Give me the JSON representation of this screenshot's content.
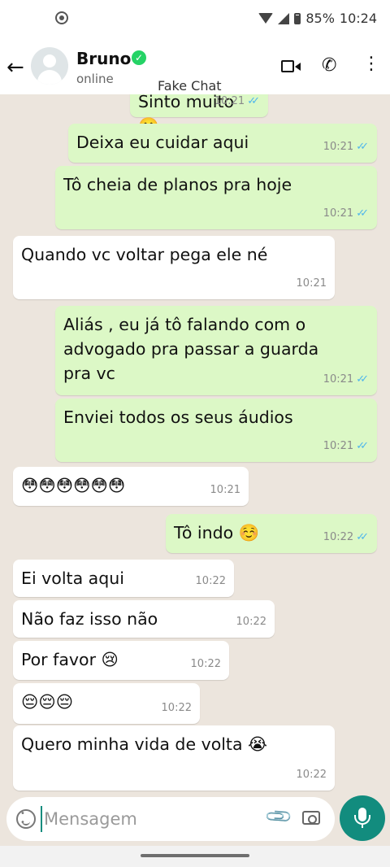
{
  "status_bar": {
    "battery": "85%",
    "time": "10:24"
  },
  "header": {
    "back_icon": "arrow-left-icon",
    "contact_name": "Bruno",
    "verified_icon": "verified-badge-icon",
    "contact_status": "online",
    "watermark": "Fake Chat",
    "actions": [
      "video-call-icon",
      "phone-icon",
      "more-vertical-icon"
    ]
  },
  "messages": [
    {
      "dir": "out",
      "text": "Sinto muito 😬",
      "time": "10:21",
      "read": true
    },
    {
      "dir": "out",
      "text": "Deixa eu cuidar aqui",
      "time": "10:21",
      "read": true
    },
    {
      "dir": "out",
      "text": "Tô cheia de planos pra hoje",
      "time": "10:21",
      "read": true
    },
    {
      "dir": "in",
      "text": "Quando vc voltar pega ele né",
      "time": "10:21"
    },
    {
      "dir": "out",
      "text": "Aliás , eu já tô falando com o\nadvogado pra passar a guarda\npra vc",
      "time": "10:21",
      "read": true
    },
    {
      "dir": "out",
      "text": "Enviei todos os seus áudios",
      "time": "10:21",
      "read": true
    },
    {
      "dir": "in",
      "text": "😳😳😳😳😳😳",
      "time": "10:21"
    },
    {
      "dir": "out",
      "text": "Tô indo ☺️",
      "time": "10:22",
      "read": true
    },
    {
      "dir": "in",
      "text": "Ei volta aqui",
      "time": "10:22"
    },
    {
      "dir": "in",
      "text": "Não faz isso não",
      "time": "10:22"
    },
    {
      "dir": "in",
      "text": "Por favor 😢",
      "time": "10:22"
    },
    {
      "dir": "in",
      "text": "😔😔😔",
      "time": "10:22"
    },
    {
      "dir": "in",
      "text": "Quero minha vida de volta 😭",
      "time": "10:22"
    }
  ],
  "composer": {
    "placeholder": "Mensagem",
    "value": "",
    "icons": [
      "emoji-icon",
      "attach-icon",
      "camera-icon"
    ],
    "send_icon": "mic-icon"
  },
  "colors": {
    "outgoing_bubble": "#dcf8c6",
    "incoming_bubble": "#ffffff",
    "chat_background": "#ece5dd",
    "accent": "#128c7e",
    "read_ticks": "#4fb6ec"
  }
}
